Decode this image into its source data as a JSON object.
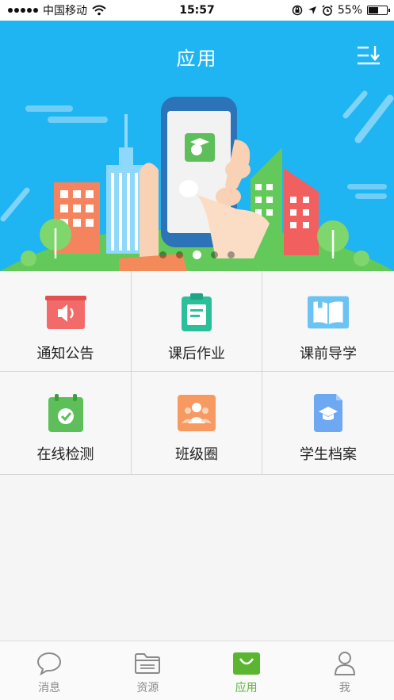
{
  "status_bar": {
    "carrier": "中国移动",
    "time": "15:57",
    "battery_percent": "55%",
    "battery_level": 0.55,
    "icons": [
      "signal-dots",
      "wifi-icon",
      "rotation-lock-icon",
      "location-icon",
      "alarm-icon",
      "battery-icon"
    ]
  },
  "header": {
    "title": "应用",
    "sort_icon": "sort-descending-icon",
    "background_color": "#1fb4f2"
  },
  "banner": {
    "slide_count": 5,
    "active_index": 2
  },
  "apps": [
    {
      "label": "通知公告",
      "icon": "megaphone-icon",
      "color": "#f36a6a"
    },
    {
      "label": "课后作业",
      "icon": "clipboard-icon",
      "color": "#2cc09a"
    },
    {
      "label": "课前导学",
      "icon": "book-icon",
      "color": "#6ac3f3"
    },
    {
      "label": "在线检测",
      "icon": "calendar-check-icon",
      "color": "#5dbe5a"
    },
    {
      "label": "班级圈",
      "icon": "people-icon",
      "color": "#f79a62"
    },
    {
      "label": "学生档案",
      "icon": "graduation-cap-icon",
      "color": "#6fa8f2"
    }
  ],
  "tabbar": {
    "tabs": [
      {
        "label": "消息",
        "icon": "chat-bubble-icon"
      },
      {
        "label": "资源",
        "icon": "folder-icon"
      },
      {
        "label": "应用",
        "icon": "apps-bag-icon"
      },
      {
        "label": "我",
        "icon": "person-icon"
      }
    ],
    "active_index": 2,
    "active_color": "#5cb531",
    "inactive_color": "#8a8a8a"
  }
}
